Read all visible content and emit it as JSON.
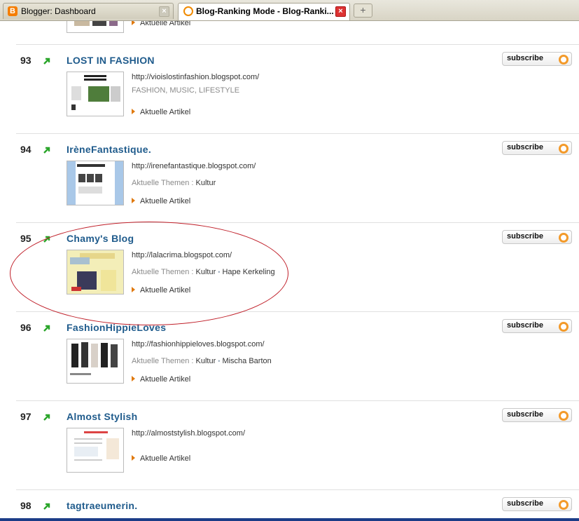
{
  "tabs": [
    {
      "title": "Blogger: Dashboard",
      "icon": "blogger-icon",
      "active": false
    },
    {
      "title": "Blog-Ranking Mode - Blog-Ranki...",
      "icon": "feed-icon",
      "active": true
    }
  ],
  "newtab_symbol": "+",
  "colors": {
    "title": "#1f5b8c",
    "rank_arrow": "#2aa52a",
    "subscribe_dot": "#f39a2a",
    "highlight_ellipse": "#c0202a"
  },
  "top_partial": {
    "articles_label": "Aktuelle Artikel"
  },
  "entries": [
    {
      "rank": "93",
      "title": "LOST IN FASHION",
      "url": "http://vioislostinfashion.blogspot.com/",
      "tags": "FASHION, MUSIC, LIFESTYLE",
      "topics_label": "",
      "topics": [],
      "articles_label": "Aktuelle Artikel",
      "subscribe_label": "subscribe"
    },
    {
      "rank": "94",
      "title": "IrèneFantastique.",
      "url": "http://irenefantastique.blogspot.com/",
      "tags": "",
      "topics_label": "Aktuelle Themen :",
      "topics": [
        "Kultur"
      ],
      "articles_label": "Aktuelle Artikel",
      "subscribe_label": "subscribe"
    },
    {
      "rank": "95",
      "title": "Chamy's Blog",
      "url": "http://lalacrima.blogspot.com/",
      "tags": "",
      "topics_label": "Aktuelle Themen :",
      "topics": [
        "Kultur",
        "Hape Kerkeling"
      ],
      "articles_label": "Aktuelle Artikel",
      "subscribe_label": "subscribe"
    },
    {
      "rank": "96",
      "title": "FashionHippieLoves",
      "url": "http://fashionhippieloves.blogspot.com/",
      "tags": "",
      "topics_label": "Aktuelle Themen :",
      "topics": [
        "Kultur",
        "Mischa Barton"
      ],
      "articles_label": "Aktuelle Artikel",
      "subscribe_label": "subscribe"
    },
    {
      "rank": "97",
      "title": "Almost Stylish",
      "url": "http://almoststylish.blogspot.com/",
      "tags": "",
      "topics_label": "",
      "topics": [],
      "articles_label": "Aktuelle Artikel",
      "subscribe_label": "subscribe"
    },
    {
      "rank": "98",
      "title": "tagtraeumerin.",
      "url": "",
      "tags": "",
      "topics_label": "",
      "topics": [],
      "articles_label": "",
      "subscribe_label": "subscribe"
    }
  ]
}
